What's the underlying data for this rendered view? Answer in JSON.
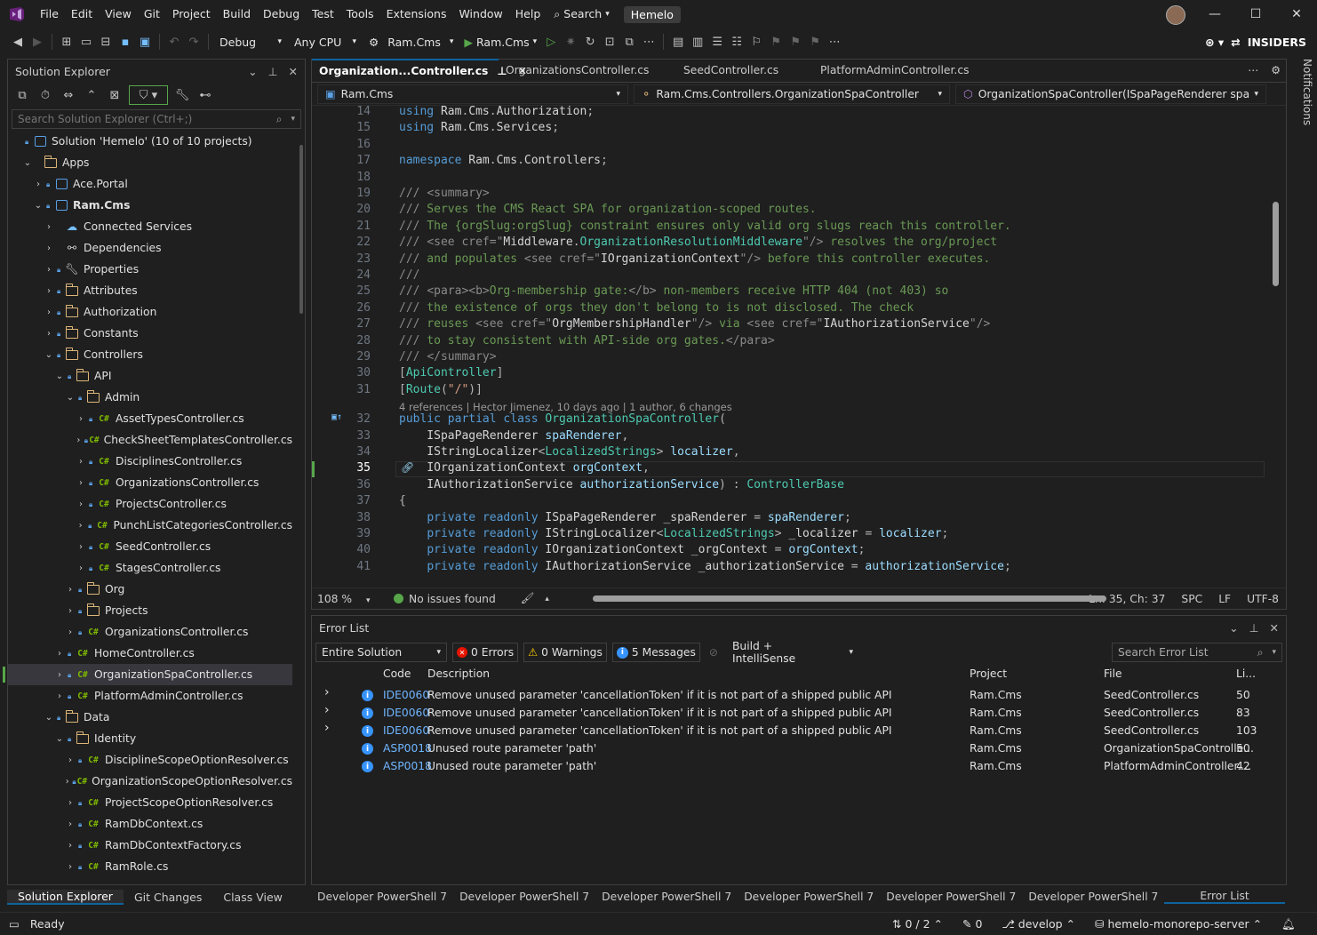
{
  "menubar": {
    "items": [
      "File",
      "Edit",
      "View",
      "Git",
      "Project",
      "Build",
      "Debug",
      "Test",
      "Tools",
      "Extensions",
      "Window",
      "Help"
    ],
    "search_label": "Search",
    "solution_name": "Hemelo"
  },
  "toolbar": {
    "config": "Debug",
    "platform": "Any CPU",
    "startup_project": "Ram.Cms",
    "run_target": "Ram.Cms",
    "insiders": "INSIDERS"
  },
  "solution_explorer": {
    "title": "Solution Explorer",
    "search_placeholder": "Search Solution Explorer (Ctrl+;)",
    "nodes": [
      {
        "label": "Solution 'Hemelo' (10 of 10 projects)",
        "depth": 0,
        "chev": "",
        "icon": "solution",
        "lock": true
      },
      {
        "label": "Apps",
        "depth": 1,
        "chev": "v",
        "icon": "folder",
        "lock": false
      },
      {
        "label": "Ace.Portal",
        "depth": 2,
        "chev": ">",
        "icon": "project",
        "lock": true
      },
      {
        "label": "Ram.Cms",
        "depth": 2,
        "chev": "v",
        "icon": "project",
        "lock": true,
        "bold": true
      },
      {
        "label": "Connected Services",
        "depth": 3,
        "chev": ">",
        "icon": "services",
        "lock": false
      },
      {
        "label": "Dependencies",
        "depth": 3,
        "chev": ">",
        "icon": "deps",
        "lock": false
      },
      {
        "label": "Properties",
        "depth": 3,
        "chev": ">",
        "icon": "props",
        "lock": true
      },
      {
        "label": "Attributes",
        "depth": 3,
        "chev": ">",
        "icon": "folder",
        "lock": true
      },
      {
        "label": "Authorization",
        "depth": 3,
        "chev": ">",
        "icon": "folder",
        "lock": true
      },
      {
        "label": "Constants",
        "depth": 3,
        "chev": ">",
        "icon": "folder",
        "lock": true
      },
      {
        "label": "Controllers",
        "depth": 3,
        "chev": "v",
        "icon": "folder",
        "lock": true
      },
      {
        "label": "API",
        "depth": 4,
        "chev": "v",
        "icon": "folder",
        "lock": true
      },
      {
        "label": "Admin",
        "depth": 5,
        "chev": "v",
        "icon": "folder",
        "lock": true
      },
      {
        "label": "AssetTypesController.cs",
        "depth": 6,
        "chev": ">",
        "icon": "cs",
        "lock": true
      },
      {
        "label": "CheckSheetTemplatesController.cs",
        "depth": 6,
        "chev": ">",
        "icon": "cs",
        "lock": true
      },
      {
        "label": "DisciplinesController.cs",
        "depth": 6,
        "chev": ">",
        "icon": "cs",
        "lock": true
      },
      {
        "label": "OrganizationsController.cs",
        "depth": 6,
        "chev": ">",
        "icon": "cs",
        "lock": true
      },
      {
        "label": "ProjectsController.cs",
        "depth": 6,
        "chev": ">",
        "icon": "cs",
        "lock": true
      },
      {
        "label": "PunchListCategoriesController.cs",
        "depth": 6,
        "chev": ">",
        "icon": "cs",
        "lock": true
      },
      {
        "label": "SeedController.cs",
        "depth": 6,
        "chev": ">",
        "icon": "cs",
        "lock": true
      },
      {
        "label": "StagesController.cs",
        "depth": 6,
        "chev": ">",
        "icon": "cs",
        "lock": true
      },
      {
        "label": "Org",
        "depth": 5,
        "chev": ">",
        "icon": "folder",
        "lock": true
      },
      {
        "label": "Projects",
        "depth": 5,
        "chev": ">",
        "icon": "folder",
        "lock": true
      },
      {
        "label": "OrganizationsController.cs",
        "depth": 5,
        "chev": ">",
        "icon": "cs",
        "lock": true
      },
      {
        "label": "HomeController.cs",
        "depth": 4,
        "chev": ">",
        "icon": "cs",
        "lock": true
      },
      {
        "label": "OrganizationSpaController.cs",
        "depth": 4,
        "chev": ">",
        "icon": "cs",
        "lock": true,
        "selected": true
      },
      {
        "label": "PlatformAdminController.cs",
        "depth": 4,
        "chev": ">",
        "icon": "cs",
        "lock": true
      },
      {
        "label": "Data",
        "depth": 3,
        "chev": "v",
        "icon": "folder",
        "lock": true
      },
      {
        "label": "Identity",
        "depth": 4,
        "chev": "v",
        "icon": "folder",
        "lock": true
      },
      {
        "label": "DisciplineScopeOptionResolver.cs",
        "depth": 5,
        "chev": ">",
        "icon": "cs",
        "lock": true
      },
      {
        "label": "OrganizationScopeOptionResolver.cs",
        "depth": 5,
        "chev": ">",
        "icon": "cs",
        "lock": true
      },
      {
        "label": "ProjectScopeOptionResolver.cs",
        "depth": 5,
        "chev": ">",
        "icon": "cs",
        "lock": true
      },
      {
        "label": "RamDbContext.cs",
        "depth": 5,
        "chev": ">",
        "icon": "cs",
        "lock": true
      },
      {
        "label": "RamDbContextFactory.cs",
        "depth": 5,
        "chev": ">",
        "icon": "cs",
        "lock": true
      },
      {
        "label": "RamRole.cs",
        "depth": 5,
        "chev": ">",
        "icon": "cs",
        "lock": true
      }
    ],
    "bottom_tabs": [
      "Solution Explorer",
      "Git Changes",
      "Class View"
    ]
  },
  "editor": {
    "tabs": [
      {
        "label": "Organization...Controller.cs",
        "active": true
      },
      {
        "label": "OrganizationsController.cs",
        "active": false
      },
      {
        "label": "SeedController.cs",
        "active": false
      },
      {
        "label": "PlatformAdminController.cs",
        "active": false
      }
    ],
    "nav": {
      "project": "Ram.Cms",
      "type": "Ram.Cms.Controllers.OrganizationSpaController",
      "member": "OrganizationSpaController(ISpaPageRenderer spaRender"
    },
    "codelens": "4 references | Hector Jimenez, 10 days ago | 1 author, 6 changes",
    "current_line": 35,
    "lines": [
      {
        "n": 14,
        "html": "<span class=kw>using</span> Ram<span class=op>.</span>Cms<span class=op>.</span>Authorization<span class=op>;</span>"
      },
      {
        "n": 15,
        "html": "<span class=kw>using</span> Ram<span class=op>.</span>Cms<span class=op>.</span>Services<span class=op>;</span>"
      },
      {
        "n": 16,
        "html": ""
      },
      {
        "n": 17,
        "html": "<span class=kw>namespace</span> Ram<span class=op>.</span>Cms<span class=op>.</span>Controllers<span class=op>;</span>"
      },
      {
        "n": 18,
        "html": ""
      },
      {
        "n": 19,
        "html": "<span class=xt>///</span> <span class=xt>&lt;summary&gt;</span>"
      },
      {
        "n": 20,
        "html": "<span class=xt>///</span><span class=cm> Serves the CMS React SPA for organization-scoped routes.</span>"
      },
      {
        "n": 21,
        "html": "<span class=xt>///</span><span class=cm> The {orgSlug:orgSlug} constraint ensures only valid org slugs reach this controller.</span>"
      },
      {
        "n": 22,
        "html": "<span class=xt>///</span> <span class=xt>&lt;see</span> <span class=xt>cref</span><span class=xt>=</span><span class=xt>\"</span>Middleware<span class=op>.</span><span class=ty>OrganizationResolutionMiddleware</span><span class=xt>\"/&gt;</span><span class=cm> resolves the org/project</span>"
      },
      {
        "n": 23,
        "html": "<span class=xt>///</span><span class=cm> and populates </span><span class=xt>&lt;see</span> <span class=xt>cref</span><span class=xt>=</span><span class=xt>\"</span>IOrganizationContext<span class=xt>\"/&gt;</span><span class=cm> before this controller executes.</span>"
      },
      {
        "n": 24,
        "html": "<span class=xt>///</span>"
      },
      {
        "n": 25,
        "html": "<span class=xt>///</span> <span class=xt>&lt;para&gt;&lt;b&gt;</span><span class=cm>Org-membership gate:</span><span class=xt>&lt;/b&gt;</span><span class=cm> non-members receive HTTP 404 (not 403) so</span>"
      },
      {
        "n": 26,
        "html": "<span class=xt>///</span><span class=cm> the existence of orgs they don't belong to is not disclosed. The check</span>"
      },
      {
        "n": 27,
        "html": "<span class=xt>///</span><span class=cm> reuses </span><span class=xt>&lt;see</span> <span class=xt>cref</span><span class=xt>=</span><span class=xt>\"</span>OrgMembershipHandler<span class=xt>\"/&gt;</span><span class=cm> via </span><span class=xt>&lt;see</span> <span class=xt>cref</span><span class=xt>=</span><span class=xt>\"</span>IAuthorizationService<span class=xt>\"/&gt;</span>"
      },
      {
        "n": 28,
        "html": "<span class=xt>///</span><span class=cm> to stay consistent with API-side org gates.</span><span class=xt>&lt;/para&gt;</span>"
      },
      {
        "n": 29,
        "html": "<span class=xt>///</span> <span class=xt>&lt;/summary&gt;</span>"
      },
      {
        "n": 30,
        "html": "<span class=op>[</span><span class=at>ApiController</span><span class=op>]</span>"
      },
      {
        "n": 31,
        "html": "<span class=op>[</span><span class=at>Route</span><span class=op>(</span><span class=st>\"/\"</span><span class=op>)]</span>"
      },
      {
        "n": 32,
        "html": "<span class=kw>public</span> <span class=kw>partial</span> <span class=kw>class</span> <span class=ty>OrganizationSpaController</span><span class=op>(</span>"
      },
      {
        "n": 33,
        "html": "    ISpaPageRenderer <span class=pa>spaRenderer</span><span class=op>,</span>"
      },
      {
        "n": 34,
        "html": "    IStringLocalizer<span class=op>&lt;</span><span class=ty>LocalizedStrings</span><span class=op>&gt;</span> <span class=pa>localizer</span><span class=op>,</span>"
      },
      {
        "n": 35,
        "html": "    IOrganizationContext <span class=pa>orgContext</span><span class=op>,</span>"
      },
      {
        "n": 36,
        "html": "    IAuthorizationService <span class=pa>authorizationService</span><span class=op>)</span> <span class=op>:</span> <span class=ty>ControllerBase</span>"
      },
      {
        "n": 37,
        "html": "<span class=op>{</span>"
      },
      {
        "n": 38,
        "html": "    <span class=kw>private</span> <span class=kw>readonly</span> ISpaPageRenderer _spaRenderer <span class=op>=</span> <span class=pa>spaRenderer</span><span class=op>;</span>"
      },
      {
        "n": 39,
        "html": "    <span class=kw>private</span> <span class=kw>readonly</span> IStringLocalizer<span class=op>&lt;</span><span class=ty>LocalizedStrings</span><span class=op>&gt;</span> _localizer <span class=op>=</span> <span class=pa>localizer</span><span class=op>;</span>"
      },
      {
        "n": 40,
        "html": "    <span class=kw>private</span> <span class=kw>readonly</span> IOrganizationContext _orgContext <span class=op>=</span> <span class=pa>orgContext</span><span class=op>;</span>"
      },
      {
        "n": 41,
        "html": "    <span class=kw>private</span> <span class=kw>readonly</span> IAuthorizationService _authorizationService <span class=op>=</span> <span class=pa>authorizationService</span><span class=op>;</span>"
      },
      {
        "n": 42,
        "html": ""
      }
    ],
    "status": {
      "zoom": "108 %",
      "issues": "No issues found",
      "position": "Ln: 35, Ch: 37",
      "spacing": "SPC",
      "eol": "LF",
      "encoding": "UTF-8"
    }
  },
  "error_list": {
    "title": "Error List",
    "scope": "Entire Solution",
    "errors": "0 Errors",
    "warnings": "0 Warnings",
    "messages": "5 Messages",
    "source": "Build + IntelliSense",
    "search_placeholder": "Search Error List",
    "columns": {
      "code": "Code",
      "description": "Description",
      "project": "Project",
      "file": "File",
      "line": "Li..."
    },
    "rows": [
      {
        "expand": true,
        "code": "IDE0060",
        "description": "Remove unused parameter 'cancellationToken' if it is not part of a shipped public API",
        "project": "Ram.Cms",
        "file": "SeedController.cs",
        "line": "50"
      },
      {
        "expand": true,
        "code": "IDE0060",
        "description": "Remove unused parameter 'cancellationToken' if it is not part of a shipped public API",
        "project": "Ram.Cms",
        "file": "SeedController.cs",
        "line": "83"
      },
      {
        "expand": true,
        "code": "IDE0060",
        "description": "Remove unused parameter 'cancellationToken' if it is not part of a shipped public API",
        "project": "Ram.Cms",
        "file": "SeedController.cs",
        "line": "103"
      },
      {
        "expand": false,
        "code": "ASP0018",
        "description": "Unused route parameter 'path'",
        "project": "Ram.Cms",
        "file": "OrganizationSpaControlle...",
        "line": "50"
      },
      {
        "expand": false,
        "code": "ASP0018",
        "description": "Unused route parameter 'path'",
        "project": "Ram.Cms",
        "file": "PlatformAdminController....",
        "line": "42"
      }
    ]
  },
  "bottom_tabs": [
    "Developer PowerShell 7",
    "Developer PowerShell 7",
    "Developer PowerShell 7",
    "Developer PowerShell 7",
    "Developer PowerShell 7",
    "Developer PowerShell 7"
  ],
  "bottom_active_tab": "Error List",
  "notifications": "Notifications",
  "statusbar": {
    "ready": "Ready",
    "commits": "0 / 2",
    "edits": "0",
    "branch": "develop",
    "repo": "hemelo-monorepo-server"
  }
}
